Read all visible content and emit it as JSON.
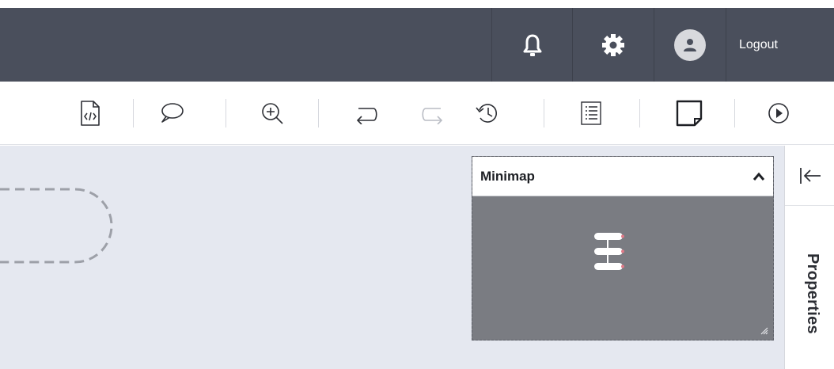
{
  "header": {
    "notifications_icon": "bell-icon",
    "settings_icon": "gear-icon",
    "avatar_icon": "user-avatar-icon",
    "logout_label": "Logout",
    "colors": {
      "background": "#4a4f5c",
      "text": "#ffffff"
    }
  },
  "toolbar": {
    "buttons": [
      {
        "name": "code-view-icon",
        "enabled": true
      },
      {
        "name": "comment-icon",
        "enabled": true
      },
      {
        "name": "zoom-in-icon",
        "enabled": true
      },
      {
        "name": "undo-icon",
        "enabled": true
      },
      {
        "name": "redo-icon",
        "enabled": false
      },
      {
        "name": "history-icon",
        "enabled": true
      },
      {
        "name": "list-icon",
        "enabled": true
      },
      {
        "name": "note-icon",
        "enabled": true
      },
      {
        "name": "play-icon",
        "enabled": true
      }
    ]
  },
  "minimap": {
    "title": "Minimap",
    "toggle_icon": "chevron-up-icon",
    "resize_icon": "resize-grip-icon"
  },
  "right_panel": {
    "collapse_icon": "collapse-left-icon",
    "properties_label": "Properties"
  },
  "canvas": {
    "background": "#e5e8f0"
  }
}
